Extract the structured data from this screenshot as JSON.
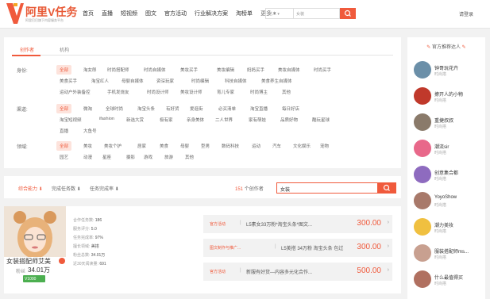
{
  "header": {
    "logo_text": "阿里V任务",
    "logo_sub": "阿里巴巴旗下内容服务平台",
    "nav": [
      "首页",
      "直播",
      "短视频",
      "图文",
      "官方活动",
      "行业解决方案",
      "淘榜单",
      "更多"
    ],
    "search_type": "达人",
    "search_placeholder": "女装",
    "login": "请登录"
  },
  "tabs": [
    "创作者",
    "机构"
  ],
  "filters": {
    "identity_label": "身份:",
    "identity": [
      "全部",
      "淘女郎",
      "时尚搭配师",
      "时尚自媒体",
      "美妆买手",
      "美妆编辑",
      "妈妈买手",
      "美妆自媒体",
      "时尚买手",
      "美食买手",
      "淘宝红人",
      "母婴自媒体",
      "资深玩家",
      "时尚编辑",
      "科技自媒体",
      "美食养生自媒体",
      "运动户外装备控",
      "手机发烧友",
      "时尚设计师",
      "美妆设计师",
      "育儿专家",
      "时尚博主",
      "其他"
    ],
    "channel_label": "渠道:",
    "channel": [
      "全部",
      "微淘",
      "全球时尚",
      "淘宝头条",
      "有好货",
      "爱逛街",
      "必买清单",
      "淘宝直播",
      "每日好店",
      "淘宝短视频",
      "ifashion",
      "新选大赏",
      "极有家",
      "亲身美体",
      "二人世界",
      "家有萌娃",
      "品质好物",
      "酷玩星球",
      "直播",
      "大鱼号"
    ],
    "field_label": "领域:",
    "field": [
      "全部",
      "美妆",
      "美妆个护",
      "居家",
      "美食",
      "母婴",
      "型男",
      "数码科技",
      "运动",
      "汽车",
      "文化娱乐",
      "宠物",
      "园艺",
      "动漫",
      "星座",
      "摄影",
      "游戏",
      "旅游",
      "其他"
    ]
  },
  "sort": {
    "items": [
      "综合能力",
      "完成任务数",
      "任务完成率"
    ],
    "count_num": "151",
    "count_suffix": "个创作者",
    "search_value": "女装"
  },
  "card": {
    "name": "女装搭配师艾美",
    "fans_label": "粉丝",
    "fans": "34.01万",
    "level": "V1000",
    "stats": [
      {
        "label": "合作任务数:",
        "value": "186"
      },
      {
        "label": "服务评分:",
        "value": "5.0"
      },
      {
        "label": "任务完成率:",
        "value": "97%"
      },
      {
        "label": "擅长领域:",
        "value": "美搭"
      },
      {
        "label": "粉丝总数:",
        "value": "34.01万"
      },
      {
        "label": "近30天阅读量:",
        "value": "691"
      }
    ],
    "services": [
      {
        "tag": "官方活动",
        "name": "L5素女33万粉*淘宝头条*图文...",
        "price": "300.00"
      },
      {
        "tag": "图文制作与推广...",
        "name": "L5美搭 34万粉 淘宝头条 包过",
        "price": "300.00"
      },
      {
        "tag": "官方活动",
        "name": "新服有好货—内容多元化合作...",
        "price": "500.00"
      }
    ]
  },
  "sidebar": {
    "title": "官方推荐达人",
    "items": [
      {
        "name": "钟哥玩花卉",
        "sub": "时尚搭",
        "color": "#6b8fa8"
      },
      {
        "name": "撩开人的小物",
        "sub": "时尚搭",
        "color": "#c0392b"
      },
      {
        "name": "重捷叔叔",
        "sub": "时尚搭",
        "color": "#8a7a6a"
      },
      {
        "name": "潮流sir",
        "sub": "时尚搭",
        "color": "#e8688a"
      },
      {
        "name": "创意集合都",
        "sub": "时尚搭",
        "color": "#8e6bbf"
      },
      {
        "name": "YoyoShow",
        "sub": "时尚搭",
        "color": "#a8796a"
      },
      {
        "name": "潮力美妆",
        "sub": "时尚搭",
        "color": "#f0c040"
      },
      {
        "name": "服装搭配师ms...",
        "sub": "时尚搭",
        "color": "#c8a090"
      },
      {
        "name": "什么最值得买",
        "sub": "时尚搭",
        "color": "#b07060"
      }
    ]
  },
  "colors": {
    "accent": "#f05a3c"
  }
}
